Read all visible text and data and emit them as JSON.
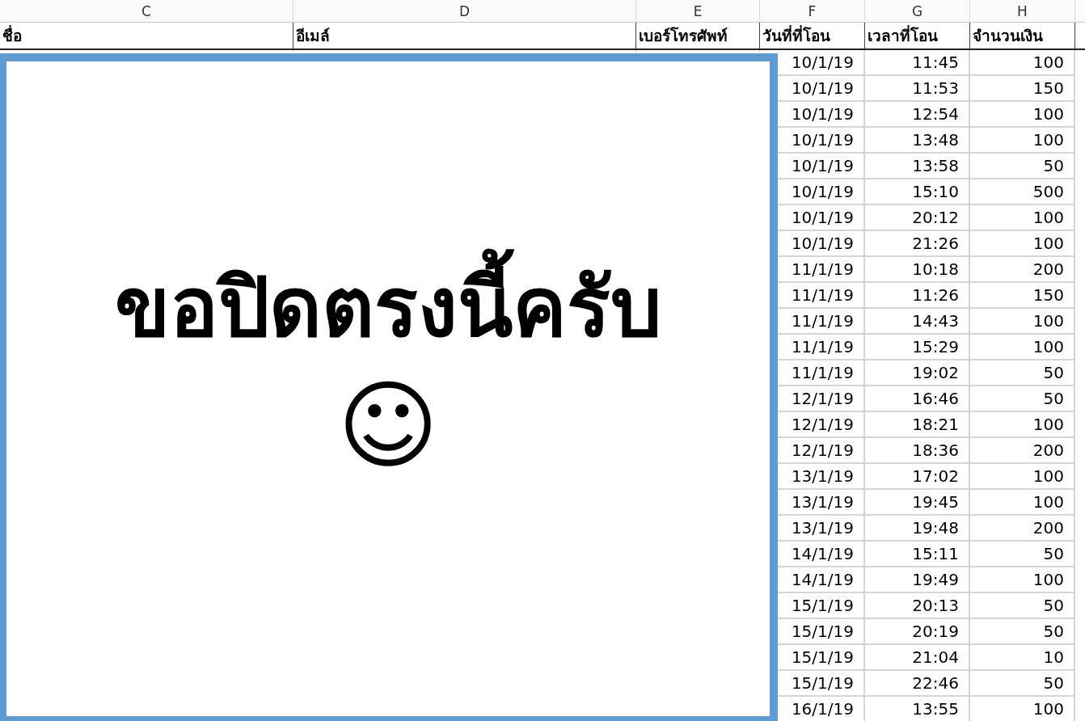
{
  "column_letters": [
    "C",
    "D",
    "E",
    "F",
    "G",
    "H"
  ],
  "headers": [
    "ชื่อ",
    "อีเมล์",
    "เบอร์โทรศัพท์",
    "วันที่ที่โอน",
    "เวลาที่โอน",
    "จำนวนเงิน"
  ],
  "rows": [
    {
      "transfer_date": "10/1/19",
      "transfer_time": "11:45",
      "amount": "100"
    },
    {
      "transfer_date": "10/1/19",
      "transfer_time": "11:53",
      "amount": "150"
    },
    {
      "transfer_date": "10/1/19",
      "transfer_time": "12:54",
      "amount": "100"
    },
    {
      "transfer_date": "10/1/19",
      "transfer_time": "13:48",
      "amount": "100"
    },
    {
      "transfer_date": "10/1/19",
      "transfer_time": "13:58",
      "amount": "50"
    },
    {
      "transfer_date": "10/1/19",
      "transfer_time": "15:10",
      "amount": "500"
    },
    {
      "transfer_date": "10/1/19",
      "transfer_time": "20:12",
      "amount": "100"
    },
    {
      "transfer_date": "10/1/19",
      "transfer_time": "21:26",
      "amount": "100"
    },
    {
      "transfer_date": "11/1/19",
      "transfer_time": "10:18",
      "amount": "200"
    },
    {
      "transfer_date": "11/1/19",
      "transfer_time": "11:26",
      "amount": "150"
    },
    {
      "transfer_date": "11/1/19",
      "transfer_time": "14:43",
      "amount": "100"
    },
    {
      "transfer_date": "11/1/19",
      "transfer_time": "15:29",
      "amount": "100"
    },
    {
      "transfer_date": "11/1/19",
      "transfer_time": "19:02",
      "amount": "50"
    },
    {
      "transfer_date": "12/1/19",
      "transfer_time": "16:46",
      "amount": "50"
    },
    {
      "transfer_date": "12/1/19",
      "transfer_time": "18:21",
      "amount": "100"
    },
    {
      "transfer_date": "12/1/19",
      "transfer_time": "18:36",
      "amount": "200"
    },
    {
      "transfer_date": "13/1/19",
      "transfer_time": "17:02",
      "amount": "100"
    },
    {
      "transfer_date": "13/1/19",
      "transfer_time": "19:45",
      "amount": "100"
    },
    {
      "transfer_date": "13/1/19",
      "transfer_time": "19:48",
      "amount": "200"
    },
    {
      "transfer_date": "14/1/19",
      "transfer_time": "15:11",
      "amount": "50"
    },
    {
      "transfer_date": "14/1/19",
      "transfer_time": "19:49",
      "amount": "100"
    },
    {
      "transfer_date": "15/1/19",
      "transfer_time": "20:13",
      "amount": "50"
    },
    {
      "transfer_date": "15/1/19",
      "transfer_time": "20:19",
      "amount": "50"
    },
    {
      "transfer_date": "15/1/19",
      "transfer_time": "21:04",
      "amount": "10"
    },
    {
      "transfer_date": "15/1/19",
      "transfer_time": "22:46",
      "amount": "50"
    },
    {
      "transfer_date": "16/1/19",
      "transfer_time": "13:55",
      "amount": "100"
    }
  ],
  "cover_note": {
    "text": "ขอปิดตรงนี้ครับ",
    "emoji": "☺"
  }
}
